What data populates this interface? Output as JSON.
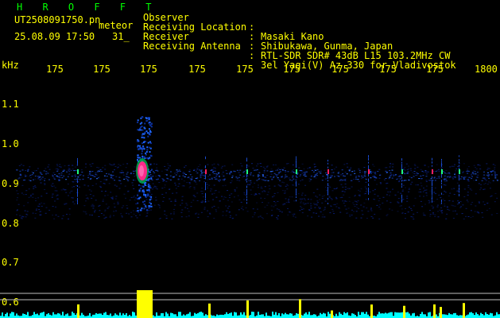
{
  "app": {
    "name": "H R O F F T",
    "filename": "UT2508091750.pn",
    "mode": "meteor",
    "datetime": "25.08.09 17:50",
    "counter": "31_"
  },
  "header": {
    "rows": [
      {
        "label": "Observer",
        "sep": ":",
        "value": "Masaki Kano"
      },
      {
        "label": "Receiving Location",
        "sep": ":",
        "value": "Shibukawa, Gunma, Japan"
      },
      {
        "label": "Receiver",
        "sep": ":",
        "value": "RTL-SDR SDR# 43dB L15 103.2MHz CW"
      },
      {
        "label": "Receiving Antenna",
        "sep": ":",
        "value": "3el Yagi(V) Az 330 for Vladivostok"
      }
    ]
  },
  "axis": {
    "y_unit": "kHz",
    "x_ticks": [
      "175",
      "175",
      "175",
      "175",
      "175",
      "175",
      "175",
      "175",
      "175",
      "1800"
    ],
    "y_ticks": [
      "1.1",
      "1.0",
      "0.9",
      "0.8",
      "0.7",
      "0.6"
    ]
  },
  "colors": {
    "text": "#ffff00",
    "title": "#00ff00",
    "background": "#000000",
    "noise": "#0a1e78",
    "trace_level": "#ffff00",
    "trace_noise": "#00ffff"
  }
}
